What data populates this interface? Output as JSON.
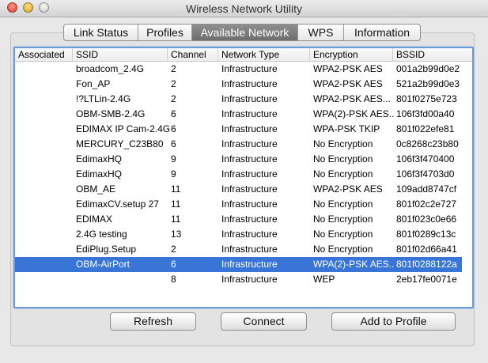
{
  "window": {
    "title": "Wireless Network Utility"
  },
  "tabs": [
    {
      "label": "Link Status"
    },
    {
      "label": "Profiles"
    },
    {
      "label": "Available Network"
    },
    {
      "label": "WPS"
    },
    {
      "label": "Information"
    }
  ],
  "active_tab": "Available Network",
  "table": {
    "columns": [
      "Associated",
      "SSID",
      "Channel",
      "Network Type",
      "Encryption",
      "BSSID"
    ],
    "rows": [
      {
        "associated": "",
        "ssid": "broadcom_2.4G",
        "channel": "2",
        "type": "Infrastructure",
        "encryption": "WPA2-PSK AES",
        "bssid": "001a2b99d0e2"
      },
      {
        "associated": "",
        "ssid": "Fon_AP",
        "channel": "2",
        "type": "Infrastructure",
        "encryption": "WPA2-PSK AES",
        "bssid": "521a2b99d0e3"
      },
      {
        "associated": "",
        "ssid": "!?LTLin-2.4G",
        "channel": "2",
        "type": "Infrastructure",
        "encryption": "WPA2-PSK AES...",
        "bssid": "801f0275e723"
      },
      {
        "associated": "",
        "ssid": "OBM-SMB-2.4G",
        "channel": "6",
        "type": "Infrastructure",
        "encryption": "WPA(2)-PSK AES...",
        "bssid": "106f3fd00a40"
      },
      {
        "associated": "",
        "ssid": "EDIMAX IP Cam-2.4G",
        "channel": "6",
        "type": "Infrastructure",
        "encryption": "WPA-PSK TKIP",
        "bssid": "801f022efe81"
      },
      {
        "associated": "",
        "ssid": "MERCURY_C23B80",
        "channel": "6",
        "type": "Infrastructure",
        "encryption": "No Encryption",
        "bssid": "0c8268c23b80"
      },
      {
        "associated": "",
        "ssid": "EdimaxHQ",
        "channel": "9",
        "type": "Infrastructure",
        "encryption": "No Encryption",
        "bssid": "106f3f470400"
      },
      {
        "associated": "",
        "ssid": "EdimaxHQ",
        "channel": "9",
        "type": "Infrastructure",
        "encryption": "No Encryption",
        "bssid": "106f3f4703d0"
      },
      {
        "associated": "",
        "ssid": "OBM_AE",
        "channel": "11",
        "type": "Infrastructure",
        "encryption": "WPA2-PSK AES",
        "bssid": "109add8747cf"
      },
      {
        "associated": "",
        "ssid": "EdimaxCV.setup 27",
        "channel": "11",
        "type": "Infrastructure",
        "encryption": "No Encryption",
        "bssid": "801f02c2e727"
      },
      {
        "associated": "",
        "ssid": "EDIMAX",
        "channel": "11",
        "type": "Infrastructure",
        "encryption": "No Encryption",
        "bssid": "801f023c0e66"
      },
      {
        "associated": "",
        "ssid": "2.4G testing",
        "channel": "13",
        "type": "Infrastructure",
        "encryption": "No Encryption",
        "bssid": "801f0289c13c"
      },
      {
        "associated": "",
        "ssid": "EdiPlug.Setup",
        "channel": "2",
        "type": "Infrastructure",
        "encryption": "No Encryption",
        "bssid": "801f02d66a41"
      },
      {
        "associated": "",
        "ssid": "OBM-AirPort",
        "channel": "6",
        "type": "Infrastructure",
        "encryption": "WPA(2)-PSK AES...",
        "bssid": "801f0288122a",
        "selected": true
      },
      {
        "associated": "",
        "ssid": "",
        "channel": "8",
        "type": "Infrastructure",
        "encryption": "WEP",
        "bssid": "2eb17fe0071e"
      }
    ]
  },
  "buttons": {
    "refresh": "Refresh",
    "connect": "Connect",
    "add_to_profile": "Add to Profile"
  },
  "colors": {
    "selection": "#3875d7",
    "list_focus_ring": "#6a9ad6"
  }
}
